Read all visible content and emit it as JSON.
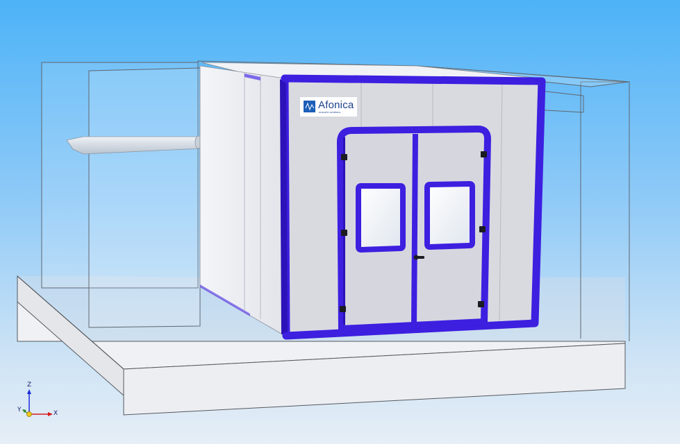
{
  "scene": {
    "logo": {
      "name": "Afonica",
      "tagline": "acoustic solutions"
    },
    "axes": {
      "z_label": "Z",
      "y_label": "Y",
      "x_label": "X",
      "colors": {
        "z": "#1a2ad8",
        "y": "#2a8a2a",
        "x": "#d81a1a"
      }
    },
    "colors": {
      "frame": "#3d1fe0",
      "panel": "#dcdde3",
      "background_top": "#4db3f7",
      "background_bottom": "#e6eef6"
    }
  }
}
